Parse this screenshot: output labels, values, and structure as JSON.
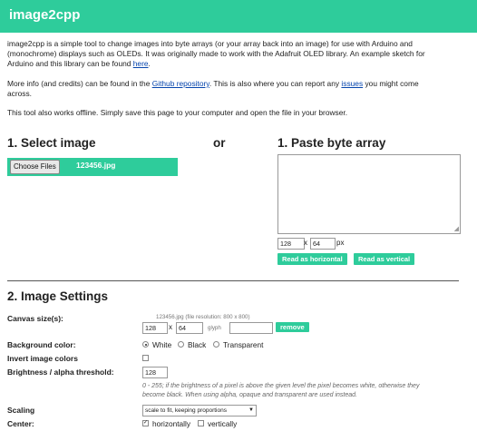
{
  "header": {
    "title": "image2cpp"
  },
  "intro": {
    "p1_a": "image2cpp is a simple tool to change images into byte arrays (or your array back into an image) for use with Arduino and",
    "p1_b": "(monochrome) displays such as OLEDs. It was originally made to work with the Adafruit OLED library. An example sketch for",
    "p1_c": "Arduino and this library can be found ",
    "p1_link": "here",
    "p1_end": ".",
    "p2_a": "More info (and credits) can be found in the ",
    "p2_link1": "Github repository",
    "p2_b": ". This is also where you can report any ",
    "p2_link2": "issues",
    "p2_c": " you might come",
    "p2_d": "across.",
    "p3": "This tool also works offline. Simply save this page to your computer and open the file in your browser."
  },
  "select_image": {
    "heading": "1. Select image",
    "choose_button": "Choose Files",
    "file_name": "123456.jpg"
  },
  "or_label": "or",
  "paste_array": {
    "heading": "1. Paste byte array",
    "textarea_value": "",
    "width": "128",
    "x_label": "x",
    "height": "64",
    "unit": "px",
    "read_horizontal": "Read as horizontal",
    "read_vertical": "Read as vertical"
  },
  "image_settings": {
    "heading": "2. Image Settings",
    "canvas_label": "Canvas size(s):",
    "canvas_note": "123456.jpg  (file resolution: 800 x 800)",
    "canvas_width": "128",
    "canvas_x": "x",
    "canvas_height": "64",
    "glyph_label": "glyph",
    "glyph_value": "",
    "remove_button": "remove",
    "bg_label": "Background color:",
    "bg_options": [
      "White",
      "Black",
      "Transparent"
    ],
    "bg_selected": "White",
    "invert_label": "Invert image colors",
    "invert_checked": false,
    "threshold_label": "Brightness / alpha threshold:",
    "threshold_value": "128",
    "threshold_desc_1": "0 - 255; if the brightness of a pixel is above the given level the pixel becomes white, otherwise they",
    "threshold_desc_2": "become black. When using alpha, opaque and transparent are used instead.",
    "scaling_label": "Scaling",
    "scaling_value": "scale to fit, keeping proportions",
    "center_label": "Center:",
    "center_options": [
      "horizontally",
      "vertically"
    ],
    "center_h_checked": true,
    "center_v_checked": false
  },
  "colors": {
    "accent": "#2ecc9b",
    "link": "#0645ad"
  }
}
